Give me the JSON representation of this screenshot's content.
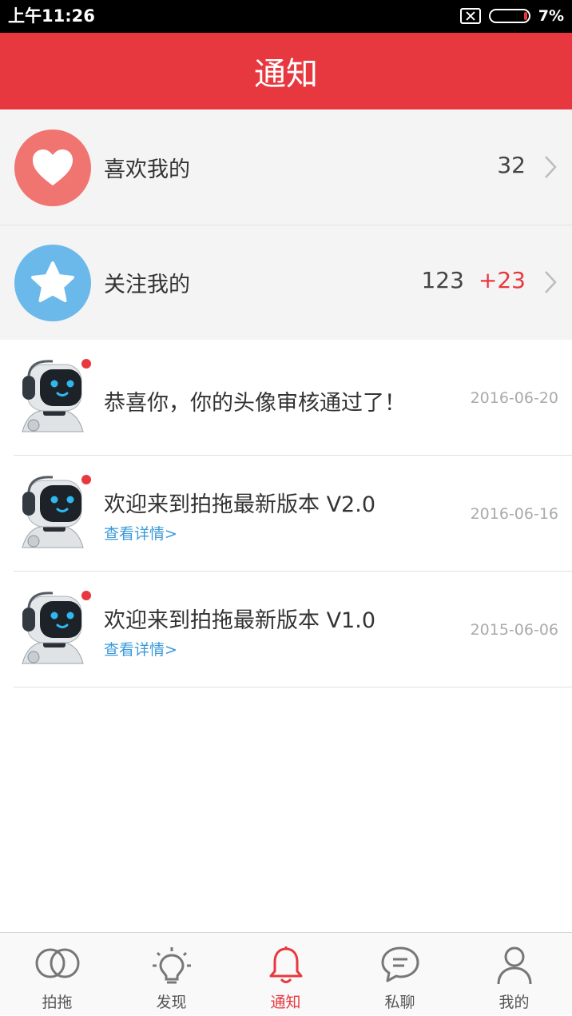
{
  "status_bar": {
    "time": "上午11:26",
    "battery_percent": "7%",
    "battery_level": 0.07
  },
  "header": {
    "title": "通知"
  },
  "summary": [
    {
      "label": "喜欢我的",
      "count": "32",
      "icon": "heart-icon",
      "color": "#f07571"
    },
    {
      "label": "关注我的",
      "count": "123",
      "new_count": "+23",
      "icon": "star-icon",
      "color": "#6bb9ea"
    }
  ],
  "notifications": [
    {
      "text": "恭喜你，你的头像审核通过了！",
      "date": "2016-06-20",
      "unread": true
    },
    {
      "title": "欢迎来到拍拖最新版本 V2.0",
      "link": "查看详情>",
      "date": "2016-06-16",
      "unread": true
    },
    {
      "title": "欢迎来到拍拖最新版本 V1.0",
      "link": "查看详情>",
      "date": "2015-06-06",
      "unread": true
    }
  ],
  "bottom_nav": [
    {
      "label": "拍拖",
      "icon": "rings-icon"
    },
    {
      "label": "发现",
      "icon": "lightbulb-icon"
    },
    {
      "label": "通知",
      "icon": "bell-icon",
      "active": true
    },
    {
      "label": "私聊",
      "icon": "chat-bubble-icon"
    },
    {
      "label": "我的",
      "icon": "person-icon"
    }
  ],
  "colors": {
    "accent": "#e8383f",
    "link": "#3a9ad9"
  }
}
